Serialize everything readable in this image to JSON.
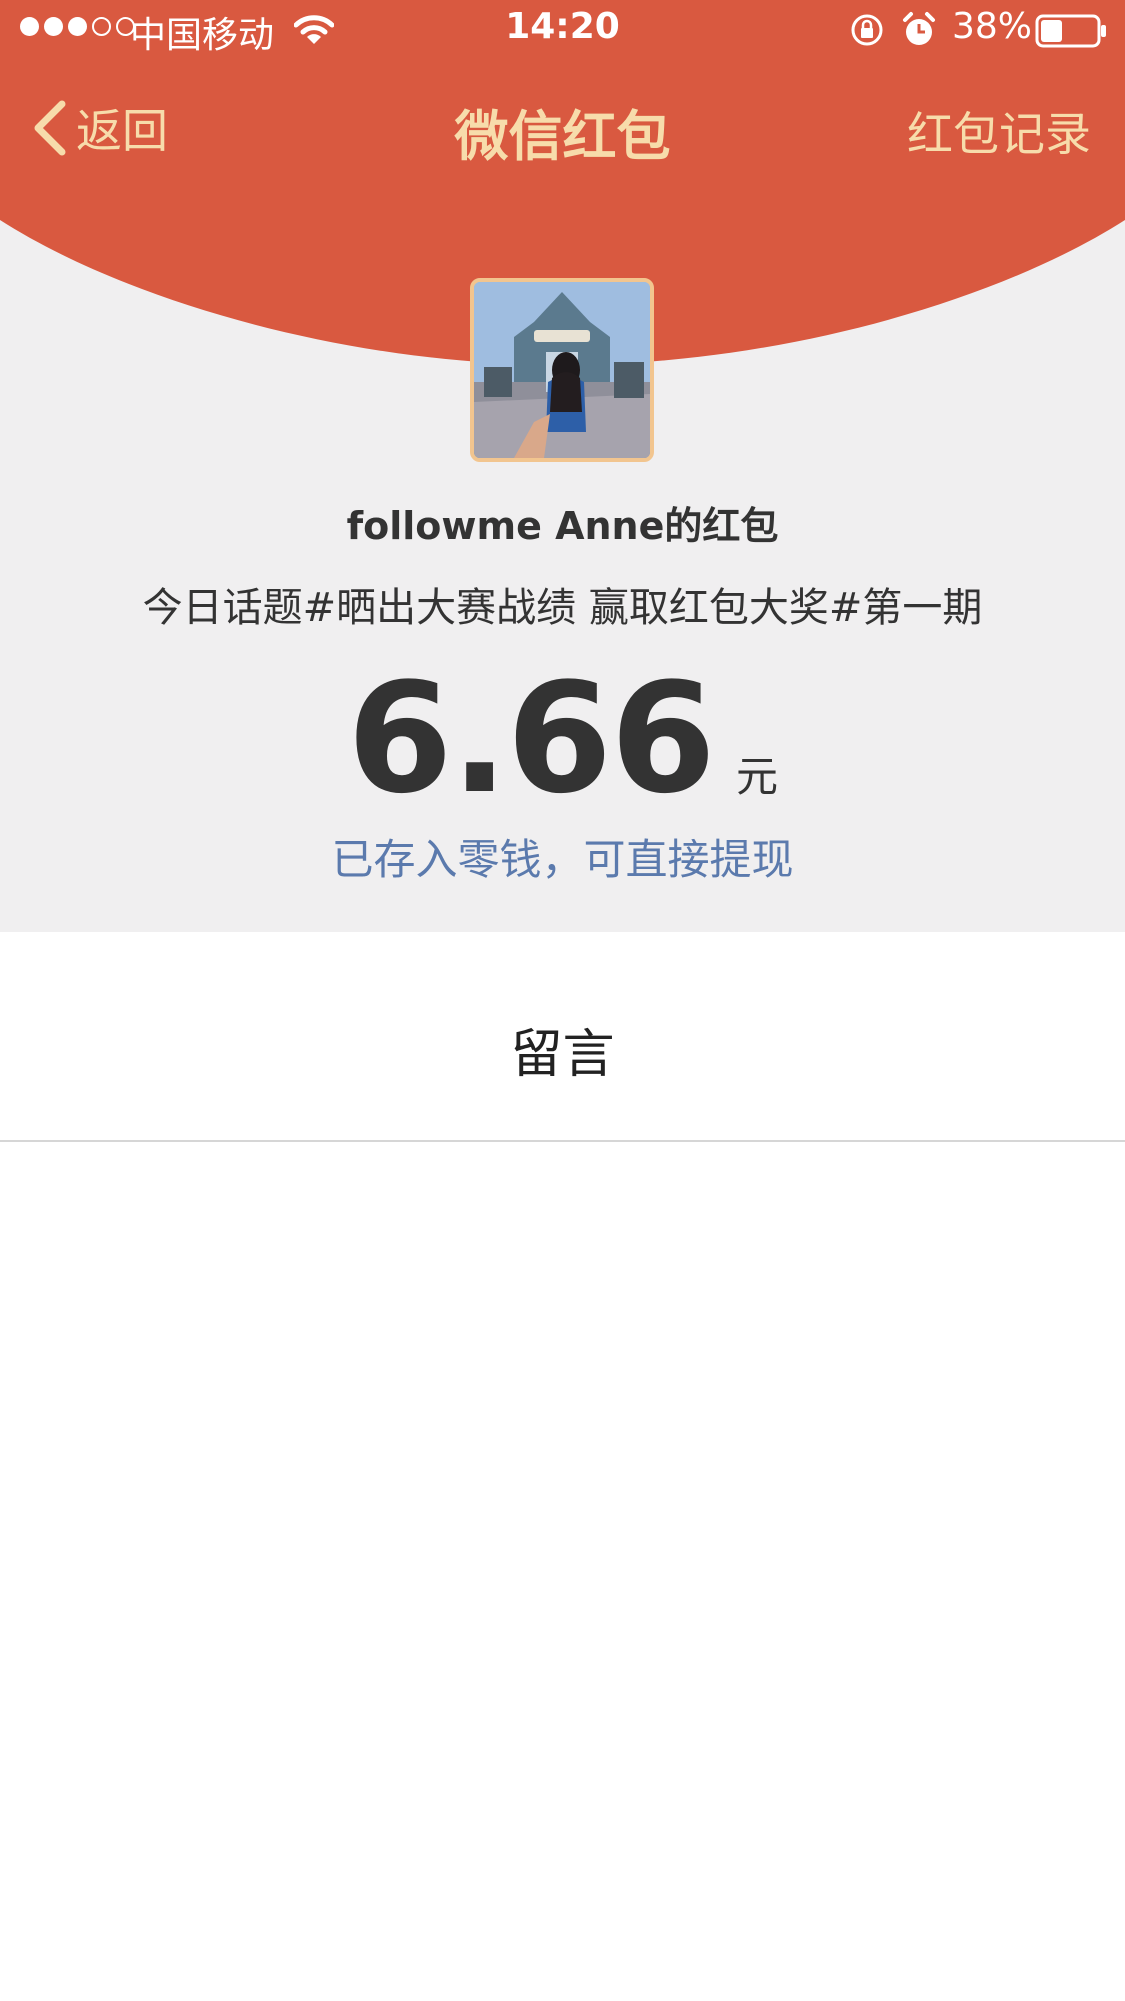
{
  "status_bar": {
    "signal_dots_full": 3,
    "signal_dots_empty": 2,
    "carrier": "中国移动",
    "time": "14:20",
    "battery_percent": "38%",
    "battery_level": 0.38,
    "icons": [
      "wifi-icon",
      "rotation-lock-icon",
      "alarm-icon",
      "battery-icon"
    ]
  },
  "nav": {
    "back_label": "返回",
    "title": "微信红包",
    "right_label": "红包记录",
    "icons": [
      "chevron-left-icon"
    ]
  },
  "red_packet": {
    "sender": "followme  Anne的红包",
    "greeting": "今日话题#晒出大赛战绩 赢取红包大奖#第一期",
    "amount": "6.66",
    "unit": "元",
    "wallet_note": "已存入零钱，可直接提现"
  },
  "message_section": {
    "title": "留言"
  },
  "colors": {
    "header_red": "#d95940",
    "nav_text": "#f7dcab",
    "page_bg": "#f0eff0",
    "link_blue": "#5b7aad",
    "text_dark": "#333333"
  }
}
